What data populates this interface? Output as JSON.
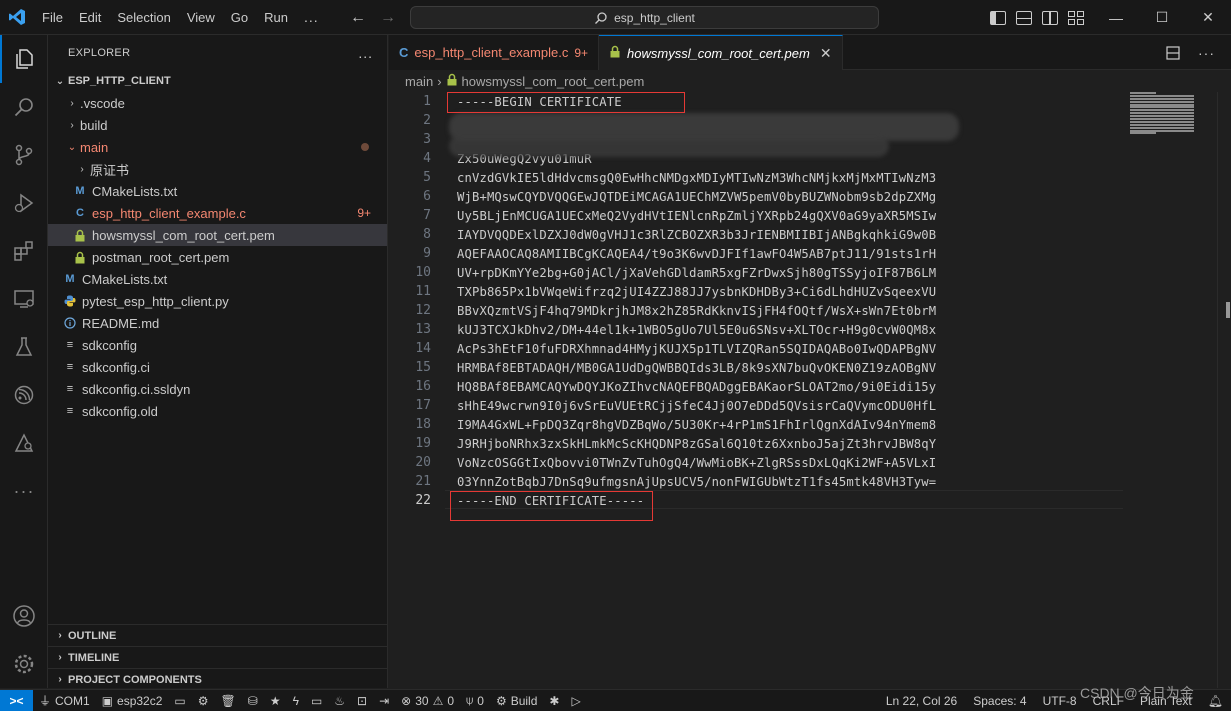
{
  "menu": [
    "File",
    "Edit",
    "Selection",
    "View",
    "Go",
    "Run",
    "..."
  ],
  "search": {
    "text": "esp_http_client"
  },
  "window_controls": {
    "minimize": "—",
    "maximize": "☐",
    "close": "✕"
  },
  "sidebar": {
    "title": "EXPLORER",
    "more": "...",
    "root": "ESP_HTTP_CLIENT",
    "tree": [
      {
        "label": ".vscode",
        "type": "folder",
        "chev": "›"
      },
      {
        "label": "build",
        "type": "folder",
        "chev": "›"
      },
      {
        "label": "main",
        "type": "folder-open",
        "chev": "⌄",
        "modified": true
      },
      {
        "label": "原证书",
        "type": "folder",
        "chev": "›"
      },
      {
        "label": "CMakeLists.txt",
        "type": "cmake"
      },
      {
        "label": "esp_http_client_example.c",
        "type": "c",
        "modified": true,
        "badge": "9+"
      },
      {
        "label": "howsmyssl_com_root_cert.pem",
        "type": "pem",
        "selected": true
      },
      {
        "label": "postman_root_cert.pem",
        "type": "pem"
      },
      {
        "label": "CMakeLists.txt",
        "type": "cmake"
      },
      {
        "label": "pytest_esp_http_client.py",
        "type": "py"
      },
      {
        "label": "README.md",
        "type": "md"
      },
      {
        "label": "sdkconfig",
        "type": "txt"
      },
      {
        "label": "sdkconfig.ci",
        "type": "txt"
      },
      {
        "label": "sdkconfig.ci.ssldyn",
        "type": "txt"
      },
      {
        "label": "sdkconfig.old",
        "type": "txt"
      }
    ],
    "panels": [
      "OUTLINE",
      "TIMELINE",
      "PROJECT COMPONENTS"
    ]
  },
  "tabs": [
    {
      "label": "esp_http_client_example.c",
      "icon": "C",
      "count": "9+"
    },
    {
      "label": "howsmyssl_com_root_cert.pem",
      "close": "✕"
    }
  ],
  "breadcrumbs": {
    "folder": "main",
    "sep": "›",
    "file": "howsmyssl_com_root_cert.pem"
  },
  "code_lines": [
    {
      "n": "1",
      "text": "-----BEGIN CERTIFICATE"
    },
    {
      "n": "2",
      "text": ""
    },
    {
      "n": "3",
      "text": ""
    },
    {
      "n": "4",
      "text": "Zx50uWegQ2vyu01muR"
    },
    {
      "n": "5",
      "text": "cnVzdGVkIE5ldHdvcmsgQ0EwHhcNMDgxMDIyMTIwNzM3WhcNMjkxMjMxMTIwNzM3"
    },
    {
      "n": "6",
      "text": "WjB+MQswCQYDVQQGEwJQTDEiMCAGA1UEChMZVW5pemV0byBUZWNobm9sb2dpZXMg"
    },
    {
      "n": "7",
      "text": "Uy5BLjEnMCUGA1UECxMeQ2VydHVtIENlcnRpZmljYXRpb24gQXV0aG9yaXR5MSIw"
    },
    {
      "n": "8",
      "text": "IAYDVQQDExlDZXJ0dW0gVHJ1c3RlZCBOZXR3b3JrIENBMIIBIjANBgkqhkiG9w0B"
    },
    {
      "n": "9",
      "text": "AQEFAAOCAQ8AMIIBCgKCAQEA4/t9o3K6wvDJFIf1awFO4W5AB7ptJ11/91sts1rH"
    },
    {
      "n": "10",
      "text": "UV+rpDKmYYe2bg+G0jACl/jXaVehGDldamR5xgFZrDwxSjh80gTSSyjoIF87B6LM"
    },
    {
      "n": "11",
      "text": "TXPb865Px1bVWqeWifrzq2jUI4ZZJ88JJ7ysbnKDHDBy3+Ci6dLhdHUZvSqeexVU"
    },
    {
      "n": "12",
      "text": "BBvXQzmtVSjF4hq79MDkrjhJM8x2hZ85RdKknvISjFH4fOQtf/WsX+sWn7Et0brM"
    },
    {
      "n": "13",
      "text": "kUJ3TCXJkDhv2/DM+44el1k+1WBO5gUo7Ul5E0u6SNsv+XLTOcr+H9g0cvW0QM8x"
    },
    {
      "n": "14",
      "text": "AcPs3hEtF10fuFDRXhmnad4HMyjKUJX5p1TLVIZQRan5SQIDAQABo0IwQDAPBgNV"
    },
    {
      "n": "15",
      "text": "HRMBAf8EBTADAQH/MB0GA1UdDgQWBBQIds3LB/8k9sXN7buQvOKEN0Z19zAOBgNV"
    },
    {
      "n": "16",
      "text": "HQ8BAf8EBAMCAQYwDQYJKoZIhvcNAQEFBQADggEBAKaorSLOAT2mo/9i0Eidi15y"
    },
    {
      "n": "17",
      "text": "sHhE49wcrwn9I0j6vSrEuVUEtRCjjSfeC4Jj0O7eDDd5QVsisrCaQVymcODU0HfL"
    },
    {
      "n": "18",
      "text": "I9MA4GxWL+FpDQ3Zqr8hgVDZBqWo/5U30Kr+4rP1mS1FhIrlQgnXdAIv94nYmem8"
    },
    {
      "n": "19",
      "text": "J9RHjboNRhx3zxSkHLmkMcScKHQDNP8zGSal6Q10tz6XxnboJ5ajZt3hrvJBW8qY"
    },
    {
      "n": "20",
      "text": "VoNzcOSGGtIxQbovvi0TWnZvTuhOgQ4/WwMioBK+ZlgRSssDxLQqKi2WF+A5VLxI"
    },
    {
      "n": "21",
      "text": "03YnnZotBqbJ7DnSq9ufmgsnAjUpsUCV5/nonFWIGUbWtzT1fs45mtk48VH3Tyw="
    },
    {
      "n": "22",
      "text": "-----END CERTIFICATE-----",
      "current": true
    }
  ],
  "statusbar": {
    "remote": "><",
    "port": "COM1",
    "target": "esp32c2",
    "errors": "30",
    "warnings": "0",
    "ports": "0",
    "build": "Build",
    "position": "Ln 22, Col 26",
    "spaces": "Spaces: 4",
    "encoding": "UTF-8",
    "eol": "CRLF",
    "language": "Plain Text"
  },
  "watermark": "CSDN @今日为金",
  "colors": {
    "accent": "#0078d4",
    "modified": "#f48771",
    "highlight_box": "#e53935"
  }
}
